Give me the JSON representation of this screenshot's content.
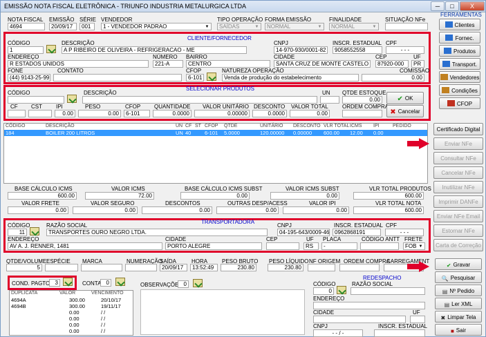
{
  "window": {
    "title": "EMISSÃO NOTA FISCAL ELETRÔNICA - TRIUNFO INDUSTRIA METALURGICA LTDA",
    "min": "─",
    "max": "□",
    "close": "X"
  },
  "header": {
    "nota_fiscal_label": "NOTA FISCAL",
    "nota_fiscal": "4694",
    "emissao_label": "EMISSÃO",
    "emissao": "20/09/17",
    "serie_label": "SÉRIE",
    "serie": "001",
    "vendedor_label": "VENDEDOR",
    "vendedor": "1 - VENDEDOR PADRAO",
    "tipo_operacao_label": "TIPO OPERAÇÃO",
    "tipo_operacao": "SAÍDAS",
    "forma_emissao_label": "FORMA EMISSÃO",
    "forma_emissao": "NORMAL",
    "finalidade_label": "FINALIDADE",
    "finalidade": "NORMAL",
    "situacao_label": "SITUAÇÃO NFe",
    "situacao": ""
  },
  "cliente": {
    "section": "CLIENTE/FORNECEDOR",
    "codigo_label": "CÓDIGO",
    "codigo": "1",
    "descricao_label": "DESCRIÇÃO",
    "descricao": "A P RIBEIRO DE OLIVEIRA - REFRIGERACAO - ME",
    "cnpj_label": "CNPJ",
    "cnpj": "14-970-930/0001-82",
    "ie_label": "INSCR. ESTADUAL",
    "ie": "9058552558",
    "cpf_label": "CPF",
    "cpf": "-   -   -",
    "endereco_label": "ENDEREÇO",
    "endereco": "R ESTADOS UNIDOS",
    "numero_label": "NÚMERO",
    "numero": "221-A",
    "bairro_label": "BAIRRO",
    "bairro": "CENTRO",
    "cidade_label": "CIDADE",
    "cidade": "SANTA CRUZ DE MONTE CASTELO",
    "cep_label": "CEP",
    "cep": "87920-000",
    "uf_label": "UF",
    "uf": "PR",
    "fone_label": "FONE",
    "fone": "(44) 9143-25-99",
    "contato_label": "CONTATO",
    "contato": "",
    "cfop_label": "CFOP",
    "cfop": "6-101",
    "natureza_label": "NATUREZA OPERAÇÃO",
    "natureza": "Venda de produção do estabelecimento",
    "comissao_label": "COMISSAO",
    "comissao": "0.00"
  },
  "produto": {
    "section": "SELECIONAR PRODUTOS",
    "codigo_label": "CÓDIGO",
    "descricao_label": "DESCRIÇÃO",
    "un_label": "UN",
    "qtde_estoque_label": "QTDE ESTOQUE",
    "qtde_estoque": "0.00",
    "cf_label": "CF",
    "cst_label": "CST",
    "ipi_label": "IPI",
    "ipi": "0.00",
    "peso_label": "PESO",
    "peso": "0.00",
    "cfop_label": "CFOP",
    "cfop": "6-101",
    "quantidade_label": "QUANTIDADE",
    "quantidade": "0.0000",
    "valor_unitario_label": "VALOR UNITÁRIO",
    "valor_unitario": "0.00000",
    "desconto_label": "DESCONTO",
    "desconto": "0.0000",
    "valor_total_label": "VALOR TOTAL",
    "valor_total": "0.00",
    "ordem_compra_label": "ORDEM COMPRA",
    "ok_label": "OK",
    "cancelar_label": "Cancelar"
  },
  "itens": {
    "headers": [
      "CÓDIGO",
      "DESCRIÇÃO",
      "UN",
      "CF",
      "ST",
      "CFOP",
      "QTDE",
      "UNITÁRIO",
      "DESCONTO",
      "VLR TOTAL",
      "ICMS",
      "IPI",
      "PEDIDO"
    ],
    "rows": [
      [
        "184",
        "BOILER 200 LITROS",
        "UN",
        "40",
        "",
        "6-101",
        "5.0000",
        "120.00000",
        "0.00000",
        "600.00",
        "12.00",
        "0.00",
        ""
      ]
    ]
  },
  "totais": {
    "base_icms_label": "BASE CÁLCULO ICMS",
    "base_icms": "600.00",
    "valor_icms_label": "VALOR ICMS",
    "valor_icms": "72.00",
    "base_subst_label": "BASE CÁLCULO ICMS SUBST",
    "base_subst": "0.00",
    "valor_subst_label": "VALOR ICMS SUBST",
    "valor_subst": "0.00",
    "vlr_produtos_label": "VLR TOTAL PRODUTOS",
    "vlr_produtos": "600.00",
    "frete_label": "VALOR FRETE",
    "frete": "0.00",
    "seguro_label": "VALOR SEGURO",
    "seguro": "0.00",
    "descontos_label": "DESCONTOS",
    "descontos": "0.00",
    "outras_label": "OUTRAS DESP/ACESS",
    "outras": "0.00",
    "ipi_label": "VALOR IPI",
    "ipi": "0.00",
    "vlr_nota_label": "VLR TOTAL NOTA",
    "vlr_nota": "600.00"
  },
  "transportadora": {
    "section": "TRANSPORTADORA",
    "codigo_label": "CÓDIGO",
    "codigo": "11",
    "razao_label": "RAZÃO SOCIAL",
    "razao": "TRANSPORTES OURO NEGRO LTDA.",
    "cnpj_label": "CNPJ",
    "cnpj": "04-195-643/0009-46",
    "ie_label": "INSCR. ESTADUAL",
    "ie": "0962868191",
    "cpf_label": "CPF",
    "cpf": "-   -   -",
    "endereco_label": "ENDEREÇO",
    "endereco": "AV A. J. RENNER, 1481",
    "cidade_label": "CIDADE",
    "cidade": "PORTO ALEGRE",
    "cep_label": "CEP",
    "cep": "",
    "uf_label": "UF",
    "uf": "RS",
    "placa_label": "PLACA",
    "placa": "-",
    "antt_label": "CÓDIGO ANTT",
    "antt": "",
    "frete_label": "FRETE",
    "frete": "FOB"
  },
  "volume": {
    "qtde_label": "QTDE/VOLUME",
    "qtde": "5",
    "especie_label": "ESPÉCIE",
    "especie": "",
    "marca_label": "MARCA",
    "marca": "",
    "numeracao_label": "NUMERAÇÃO",
    "numeracao": "",
    "saida_label": "SAÍDA",
    "saida": "20/09/17",
    "hora_label": "HORA",
    "hora": "13:52:49",
    "peso_bruto_label": "PESO BRUTO",
    "peso_bruto": "230.80",
    "peso_liquido_label": "PESO LÍQUIDO",
    "peso_liquido": "230.80",
    "nf_origem_label": "NF ORIGEM",
    "ordem_compra_label": "ORDEM COMPRA",
    "carregamento_label": "CARREGAMENT"
  },
  "pagamento": {
    "cond_label": "COND. PAGTO",
    "cond": "3",
    "conta_label": "CONTA",
    "conta": "0",
    "headers": [
      "DUPLICATA",
      "VALOR",
      "VENCIMENTO"
    ],
    "rows": [
      [
        "4694A",
        "300.00",
        "20/10/17"
      ],
      [
        "4694B",
        "300.00",
        "19/11/17"
      ],
      [
        "",
        "0.00",
        "/  /"
      ],
      [
        "",
        "0.00",
        "/  /"
      ],
      [
        "",
        "0.00",
        "/  /"
      ],
      [
        "",
        "0.00",
        "/  /"
      ]
    ]
  },
  "observacoes": {
    "label": "OBSERVAÇÕES",
    "value": "0"
  },
  "redespacho": {
    "section": "REDESPACHO",
    "codigo_label": "CÓDIGO",
    "codigo": "0",
    "razao_label": "RAZÃO SOCIAL",
    "endereco_label": "ENDEREÇO",
    "cidade_label": "CIDADE",
    "uf_label": "UF",
    "cnpj_label": "CNPJ",
    "cnpj": "-   -   /   -",
    "ie_label": "INSCR. ESTADUAL"
  },
  "ferramentas": {
    "section": "FERRAMENTAS",
    "top": [
      "Clientes",
      "Fornec.",
      "Produtos",
      "Transport.",
      "Vendedores",
      "Condições",
      "CFOP"
    ],
    "nfe": [
      "Certificado Digital",
      "Enviar NFe",
      "Consultar NFe",
      "Cancelar NFe",
      "Inutilizar NFe",
      "Imprimir DANFe",
      "Enviar NFe Email",
      "Estornar NFe",
      "Carta de Correção"
    ],
    "bottom": [
      "Gravar",
      "Pesquisar",
      "Nº Pedido",
      "Ler XML",
      "Limpar Tela",
      "Sair"
    ]
  }
}
